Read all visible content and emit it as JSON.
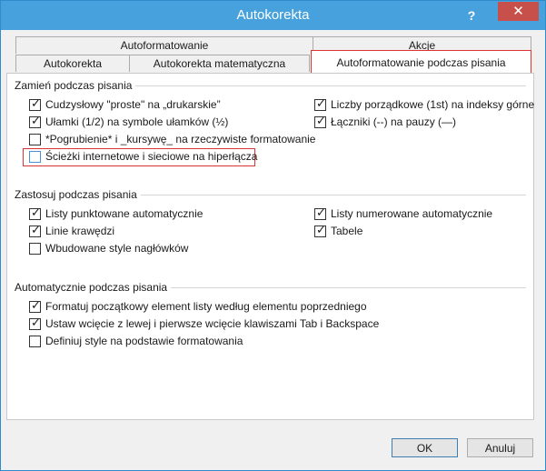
{
  "window": {
    "title": "Autokorekta",
    "help_glyph": "?",
    "close_glyph": "✕"
  },
  "tabs": {
    "row1": [
      "Autoformatowanie",
      "Akcje"
    ],
    "row2": [
      "Autokorekta",
      "Autokorekta matematyczna",
      "Autoformatowanie podczas pisania"
    ]
  },
  "sections": {
    "replace": {
      "title": "Zamień podczas pisania",
      "left": [
        {
          "label": "Cudzysłowy \"proste\" na „drukarskie”",
          "checked": true
        },
        {
          "label": "Ułamki (1/2) na symbole ułamków (½)",
          "checked": true
        },
        {
          "label": "*Pogrubienie* i _kursywę_ na rzeczywiste formatowanie",
          "checked": false
        },
        {
          "label": "Ścieżki internetowe i sieciowe na hiperłącza",
          "checked": false
        }
      ],
      "right": [
        {
          "label": "Liczby porządkowe (1st) na indeksy górne",
          "checked": true
        },
        {
          "label": "Łączniki (--) na pauzy (—)",
          "checked": true
        }
      ]
    },
    "apply": {
      "title": "Zastosuj podczas pisania",
      "left": [
        {
          "label": "Listy punktowane automatycznie",
          "checked": true
        },
        {
          "label": "Linie krawędzi",
          "checked": true
        },
        {
          "label": "Wbudowane style nagłówków",
          "checked": false
        }
      ],
      "right": [
        {
          "label": "Listy numerowane automatycznie",
          "checked": true
        },
        {
          "label": "Tabele",
          "checked": true
        }
      ]
    },
    "auto": {
      "title": "Automatycznie podczas pisania",
      "items": [
        {
          "label": "Formatuj początkowy element listy według elementu poprzedniego",
          "checked": true
        },
        {
          "label": "Ustaw wcięcie z lewej i pierwsze wcięcie klawiszami Tab i Backspace",
          "checked": true
        },
        {
          "label": "Definiuj style na podstawie formatowania",
          "checked": false
        }
      ]
    }
  },
  "buttons": {
    "ok": "OK",
    "cancel": "Anuluj"
  },
  "check_glyph": "✓"
}
